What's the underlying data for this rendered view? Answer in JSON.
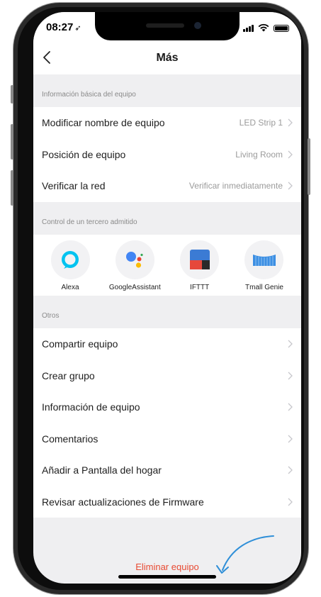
{
  "status_bar": {
    "time": "08:27"
  },
  "nav": {
    "title": "Más"
  },
  "sections": {
    "basic": {
      "header": "Información básica del equipo",
      "rows": [
        {
          "label": "Modificar nombre de equipo",
          "value": "LED Strip 1"
        },
        {
          "label": "Posición de equipo",
          "value": "Living Room"
        },
        {
          "label": "Verificar la red",
          "value": "Verificar inmediatamente"
        }
      ]
    },
    "third_party": {
      "header": "Control de un tercero admitido",
      "items": [
        {
          "label": "Alexa",
          "icon": "alexa-icon"
        },
        {
          "label": "GoogleAssistant",
          "icon": "google-assistant-icon"
        },
        {
          "label": "IFTTT",
          "icon": "ifttt-icon"
        },
        {
          "label": "Tmall Genie",
          "icon": "tmall-genie-icon"
        }
      ]
    },
    "others": {
      "header": "Otros",
      "rows": [
        {
          "label": "Compartir equipo"
        },
        {
          "label": "Crear grupo"
        },
        {
          "label": "Información de equipo"
        },
        {
          "label": "Comentarios"
        },
        {
          "label": "Añadir a Pantalla del hogar"
        },
        {
          "label": "Revisar actualizaciones de Firmware"
        }
      ]
    }
  },
  "delete_button": {
    "label": "Eliminar equipo"
  },
  "colors": {
    "accent_red": "#e84a33",
    "arrow_blue": "#2f8fd8",
    "background": "#efeff1"
  }
}
